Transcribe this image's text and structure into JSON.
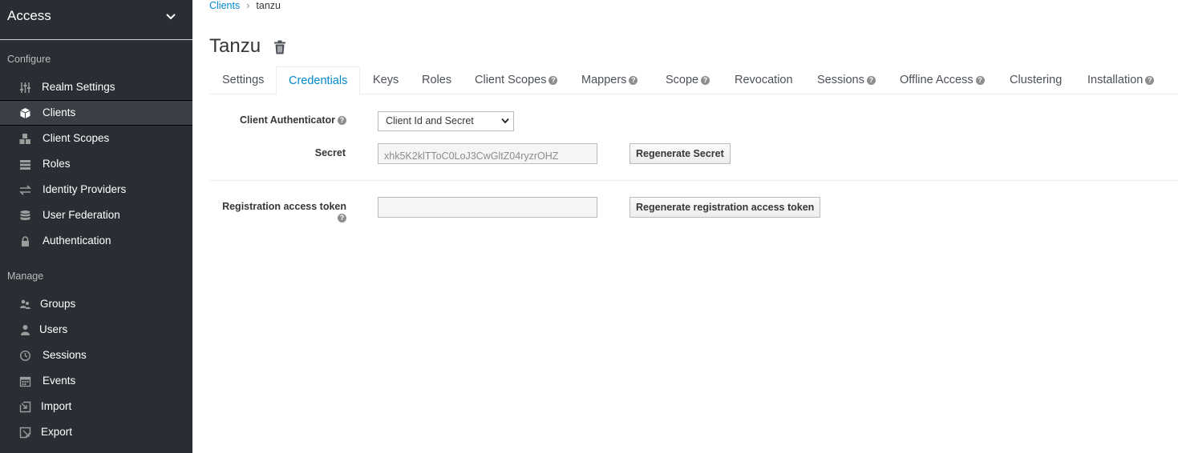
{
  "sidebar": {
    "realm_name": "Access",
    "section_configure": "Configure",
    "section_manage": "Manage",
    "configure_items": [
      {
        "label": "Realm Settings",
        "icon": "sliders-icon"
      },
      {
        "label": "Clients",
        "icon": "cube-icon",
        "active": true
      },
      {
        "label": "Client Scopes",
        "icon": "cubes-icon"
      },
      {
        "label": "Roles",
        "icon": "list-icon"
      },
      {
        "label": "Identity Providers",
        "icon": "exchange-icon"
      },
      {
        "label": "User Federation",
        "icon": "database-icon"
      },
      {
        "label": "Authentication",
        "icon": "lock-icon"
      }
    ],
    "manage_items": [
      {
        "label": "Groups",
        "icon": "users-icon"
      },
      {
        "label": "Users",
        "icon": "user-icon"
      },
      {
        "label": "Sessions",
        "icon": "clock-icon"
      },
      {
        "label": "Events",
        "icon": "calendar-icon"
      },
      {
        "label": "Import",
        "icon": "import-icon"
      },
      {
        "label": "Export",
        "icon": "export-icon"
      }
    ]
  },
  "breadcrumb": {
    "parent": "Clients",
    "separator": "›",
    "current": "tanzu"
  },
  "page": {
    "title": "Tanzu"
  },
  "tabs": [
    {
      "label": "Settings"
    },
    {
      "label": "Credentials",
      "active": true
    },
    {
      "label": "Keys"
    },
    {
      "label": "Roles"
    },
    {
      "label": "Client Scopes",
      "help": true
    },
    {
      "label": "Mappers",
      "help": true
    },
    {
      "label": "Scope",
      "help": true
    },
    {
      "label": "Revocation"
    },
    {
      "label": "Sessions",
      "help": true
    },
    {
      "label": "Offline Access",
      "help": true
    },
    {
      "label": "Clustering"
    },
    {
      "label": "Installation",
      "help": true
    }
  ],
  "form": {
    "authenticator_label": "Client Authenticator",
    "authenticator_value": "Client Id and Secret",
    "secret_label": "Secret",
    "secret_value": "xhk5K2klTToC0LoJ3CwGltZ04ryzrOHZ",
    "regenerate_secret": "Regenerate Secret",
    "registration_label": "Registration access token",
    "registration_value": "",
    "regenerate_registration": "Regenerate registration access token"
  },
  "colors": {
    "sidebar_bg": "#292e34",
    "accent": "#0088ce",
    "active_item_bg": "#393f44"
  }
}
